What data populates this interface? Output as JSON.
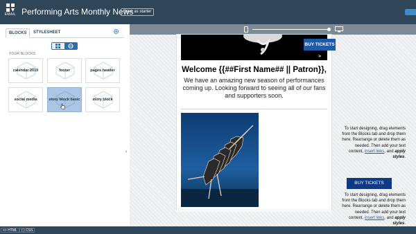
{
  "header": {
    "logo_label": "EMAIL",
    "title": "Performing Arts Monthly News",
    "save_starter": "Save as starter"
  },
  "left_panel": {
    "tabs": [
      "BLOCKS",
      "STYLESHEET"
    ],
    "section_label": "YOUR BLOCKS",
    "blocks": [
      {
        "label": "calendar 2019"
      },
      {
        "label": "footer"
      },
      {
        "label": "pages header"
      },
      {
        "label": "social media"
      },
      {
        "label": "story block basic",
        "selected": true
      },
      {
        "label": "story block"
      }
    ]
  },
  "bottom_bar": {
    "html_label": "<> HTML",
    "css_label": "{ } CSS"
  },
  "email": {
    "hero_button": "BUY TICKETS  >",
    "welcome": "Welcome {{##First Name## || Patron}},",
    "intro": "We have an amazing new season of performances coming up. Looking forward to seeing all of our fans and supporters soon.",
    "side_text_1": "To start designing, drag elements from the Blocks tab and drop them here. Rearrange or delete them as needed. Then add your text content,",
    "link_text": "insert links",
    "and_text": ", and",
    "apply_styles": "apply styles",
    "period": ".",
    "buy_button": "BUY TICKETS",
    "side_text_2": "To start designing, drag elements from the Blocks tab and drop them here. Rearrange or delete them as needed. Then add your text content,"
  },
  "colors": {
    "header_bg": "#2f4558",
    "accent": "#1f5aa6",
    "button_dark": "#0d3a82",
    "selected_block": "#a9c7e5"
  }
}
